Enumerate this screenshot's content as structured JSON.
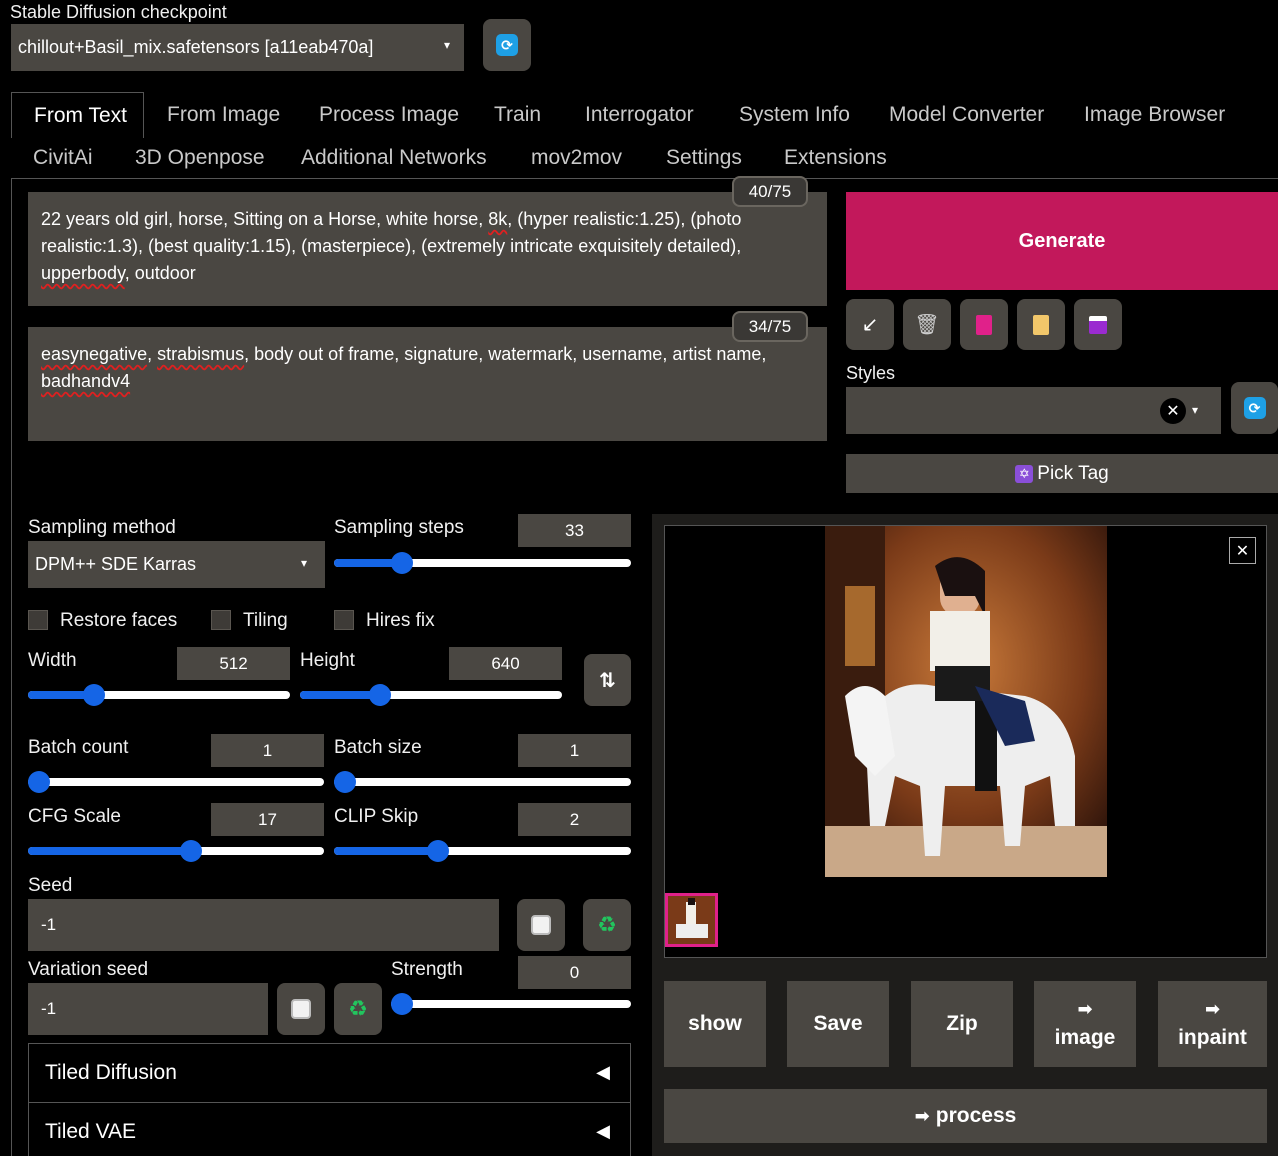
{
  "checkpoint": {
    "label": "Stable Diffusion checkpoint",
    "value": "chillout+Basil_mix.safetensors [a11eab470a]"
  },
  "tabs_row1": [
    "From Text",
    "From Image",
    "Process Image",
    "Train",
    "Interrogator",
    "System Info",
    "Model Converter",
    "Image Browser"
  ],
  "tabs_row2": [
    "CivitAi",
    "3D Openpose",
    "Additional Networks",
    "mov2mov",
    "Settings",
    "Extensions"
  ],
  "prompt": {
    "counter": "40/75",
    "line1_a": "22 years old girl, horse, Sitting on a Horse, white horse, ",
    "line1_b": "8k",
    "line1_c": ", (hyper realistic:1.25), (photo",
    "line2": "realistic:1.3), (best quality:1.15), (masterpiece), (extremely intricate exquisitely detailed),",
    "line3_a": "upperbody",
    "line3_b": ", outdoor"
  },
  "negative": {
    "counter": "34/75",
    "line1_a": "easynegative",
    "line1_b": ", ",
    "line1_c": "strabismus",
    "line1_d": ", body out of frame, signature, watermark, username, artist name,",
    "line2": "badhandv4"
  },
  "generate_label": "Generate",
  "styles_label": "Styles",
  "pick_tag_label": "Pick Tag",
  "sampling_method": {
    "label": "Sampling method",
    "value": "DPM++ SDE Karras"
  },
  "sampling_steps": {
    "label": "Sampling steps",
    "value": "33",
    "fraction": 0.23
  },
  "checkboxes": [
    "Restore faces",
    "Tiling",
    "Hires fix"
  ],
  "width": {
    "label": "Width",
    "value": "512",
    "fraction": 0.25
  },
  "height": {
    "label": "Height",
    "value": "640",
    "fraction": 0.305
  },
  "batch_count": {
    "label": "Batch count",
    "value": "1",
    "fraction": 0.0
  },
  "batch_size": {
    "label": "Batch size",
    "value": "1",
    "fraction": 0.0
  },
  "cfg_scale": {
    "label": "CFG Scale",
    "value": "17",
    "fraction": 0.55
  },
  "clip_skip": {
    "label": "CLIP Skip",
    "value": "2",
    "fraction": 0.35
  },
  "seed": {
    "label": "Seed",
    "value": "-1"
  },
  "variation_seed": {
    "label": "Variation seed",
    "value": "-1"
  },
  "strength": {
    "label": "Strength",
    "value": "0",
    "fraction": 0.0
  },
  "accordions": [
    "Tiled Diffusion",
    "Tiled VAE"
  ],
  "output_buttons": {
    "show": "show",
    "save": "Save",
    "zip": "Zip",
    "image": "image",
    "inpaint": "inpaint",
    "process": "process"
  },
  "colors": {
    "generate": "#c2185b",
    "accent_blue": "#1565e6"
  }
}
